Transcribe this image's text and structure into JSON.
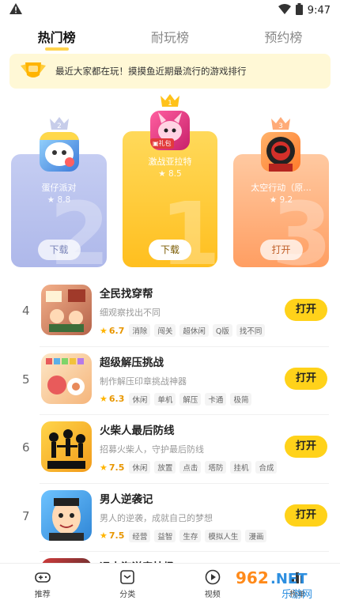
{
  "status": {
    "time": "9:47",
    "warning_icon": "warning-icon"
  },
  "tabs": [
    {
      "label": "热门榜",
      "active": true
    },
    {
      "label": "耐玩榜",
      "active": false
    },
    {
      "label": "预约榜",
      "active": false
    }
  ],
  "banner": {
    "text": "最近大家都在玩！摸摸鱼近期最流行的游戏排行"
  },
  "podium": {
    "first": {
      "rank": "1",
      "name": "激战亚拉特",
      "score": "8.5",
      "button": "下载",
      "badge": "礼包"
    },
    "second": {
      "rank": "2",
      "name": "蛋仔派对",
      "score": "8.8",
      "button": "下载"
    },
    "third": {
      "rank": "3",
      "name": "太空行动（原...",
      "score": "9.2",
      "button": "打开"
    }
  },
  "list": [
    {
      "rank": "4",
      "title": "全民找穿帮",
      "desc": "细观察找出不同",
      "score": "6.7",
      "tags": [
        "消除",
        "闯关",
        "超休闲",
        "Q版",
        "找不同"
      ],
      "button": "打开"
    },
    {
      "rank": "5",
      "title": "超级解压挑战",
      "desc": "制作解压印章挑战神器",
      "score": "6.3",
      "tags": [
        "休闲",
        "单机",
        "解压",
        "卡通",
        "极简"
      ],
      "button": "打开"
    },
    {
      "rank": "6",
      "title": "火柴人最后防线",
      "desc": "招募火柴人，守护最后防线",
      "score": "7.5",
      "tags": [
        "休闲",
        "放置",
        "点击",
        "塔防",
        "挂机",
        "合成"
      ],
      "button": "打开"
    },
    {
      "rank": "7",
      "title": "男人逆袭记",
      "desc": "男人的逆袭，成就自己的梦想",
      "score": "7.5",
      "tags": [
        "经营",
        "益智",
        "生存",
        "模拟人生",
        "漫画"
      ],
      "button": "打开"
    },
    {
      "rank": "8",
      "title": "远古海洋竞技场",
      "desc": "",
      "score": "",
      "tags": [],
      "button": ""
    }
  ],
  "nav": [
    {
      "label": "推荐",
      "icon": "gamepad-icon"
    },
    {
      "label": "分类",
      "icon": "category-icon"
    },
    {
      "label": "视频",
      "icon": "play-icon"
    },
    {
      "label": "榜单",
      "icon": "ranking-icon"
    }
  ],
  "watermark": {
    "text": "962.NET",
    "sub": "乐游网"
  },
  "colors": {
    "accent": "#ffd21a",
    "gold": "#ffbf1f",
    "silver": "#aeb8ea",
    "bronze": "#ff9e62"
  }
}
